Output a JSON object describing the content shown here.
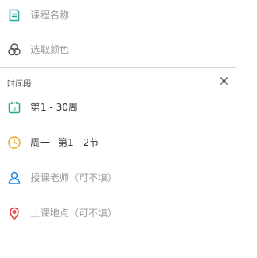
{
  "course_name": {
    "placeholder": "课程名称"
  },
  "color_picker": {
    "placeholder": "选取颜色"
  },
  "time_section": {
    "title": "时间段",
    "weeks": "第1 - 30周",
    "weekday": "周一",
    "periods": "第1 - 2节",
    "teacher_placeholder": "授课老师（可不填）",
    "location_placeholder": "上课地点（可不填）"
  },
  "colors": {
    "teal": "#26a69a",
    "orange": "#f5a623",
    "blue": "#1e88e5",
    "red": "#e53935",
    "gray": "#555555"
  },
  "icons": {
    "course": "note-icon",
    "color": "palette-circles-icon",
    "close": "close-icon",
    "weeks": "calendar-3-icon",
    "time": "clock-icon",
    "teacher": "person-icon",
    "location": "map-pin-icon"
  }
}
